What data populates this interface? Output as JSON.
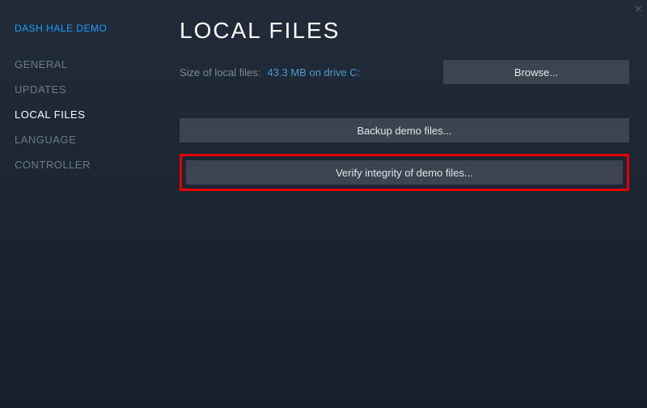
{
  "game_title": "DASH HALE DEMO",
  "close_label": "×",
  "sidebar": {
    "items": [
      {
        "label": "GENERAL",
        "active": false
      },
      {
        "label": "UPDATES",
        "active": false
      },
      {
        "label": "LOCAL FILES",
        "active": true
      },
      {
        "label": "LANGUAGE",
        "active": false
      },
      {
        "label": "CONTROLLER",
        "active": false
      }
    ]
  },
  "main": {
    "title": "LOCAL FILES",
    "info_label": "Size of local files:",
    "info_value": "43.3 MB on drive C:",
    "browse_label": "Browse...",
    "backup_label": "Backup demo files...",
    "verify_label": "Verify integrity of demo files..."
  }
}
